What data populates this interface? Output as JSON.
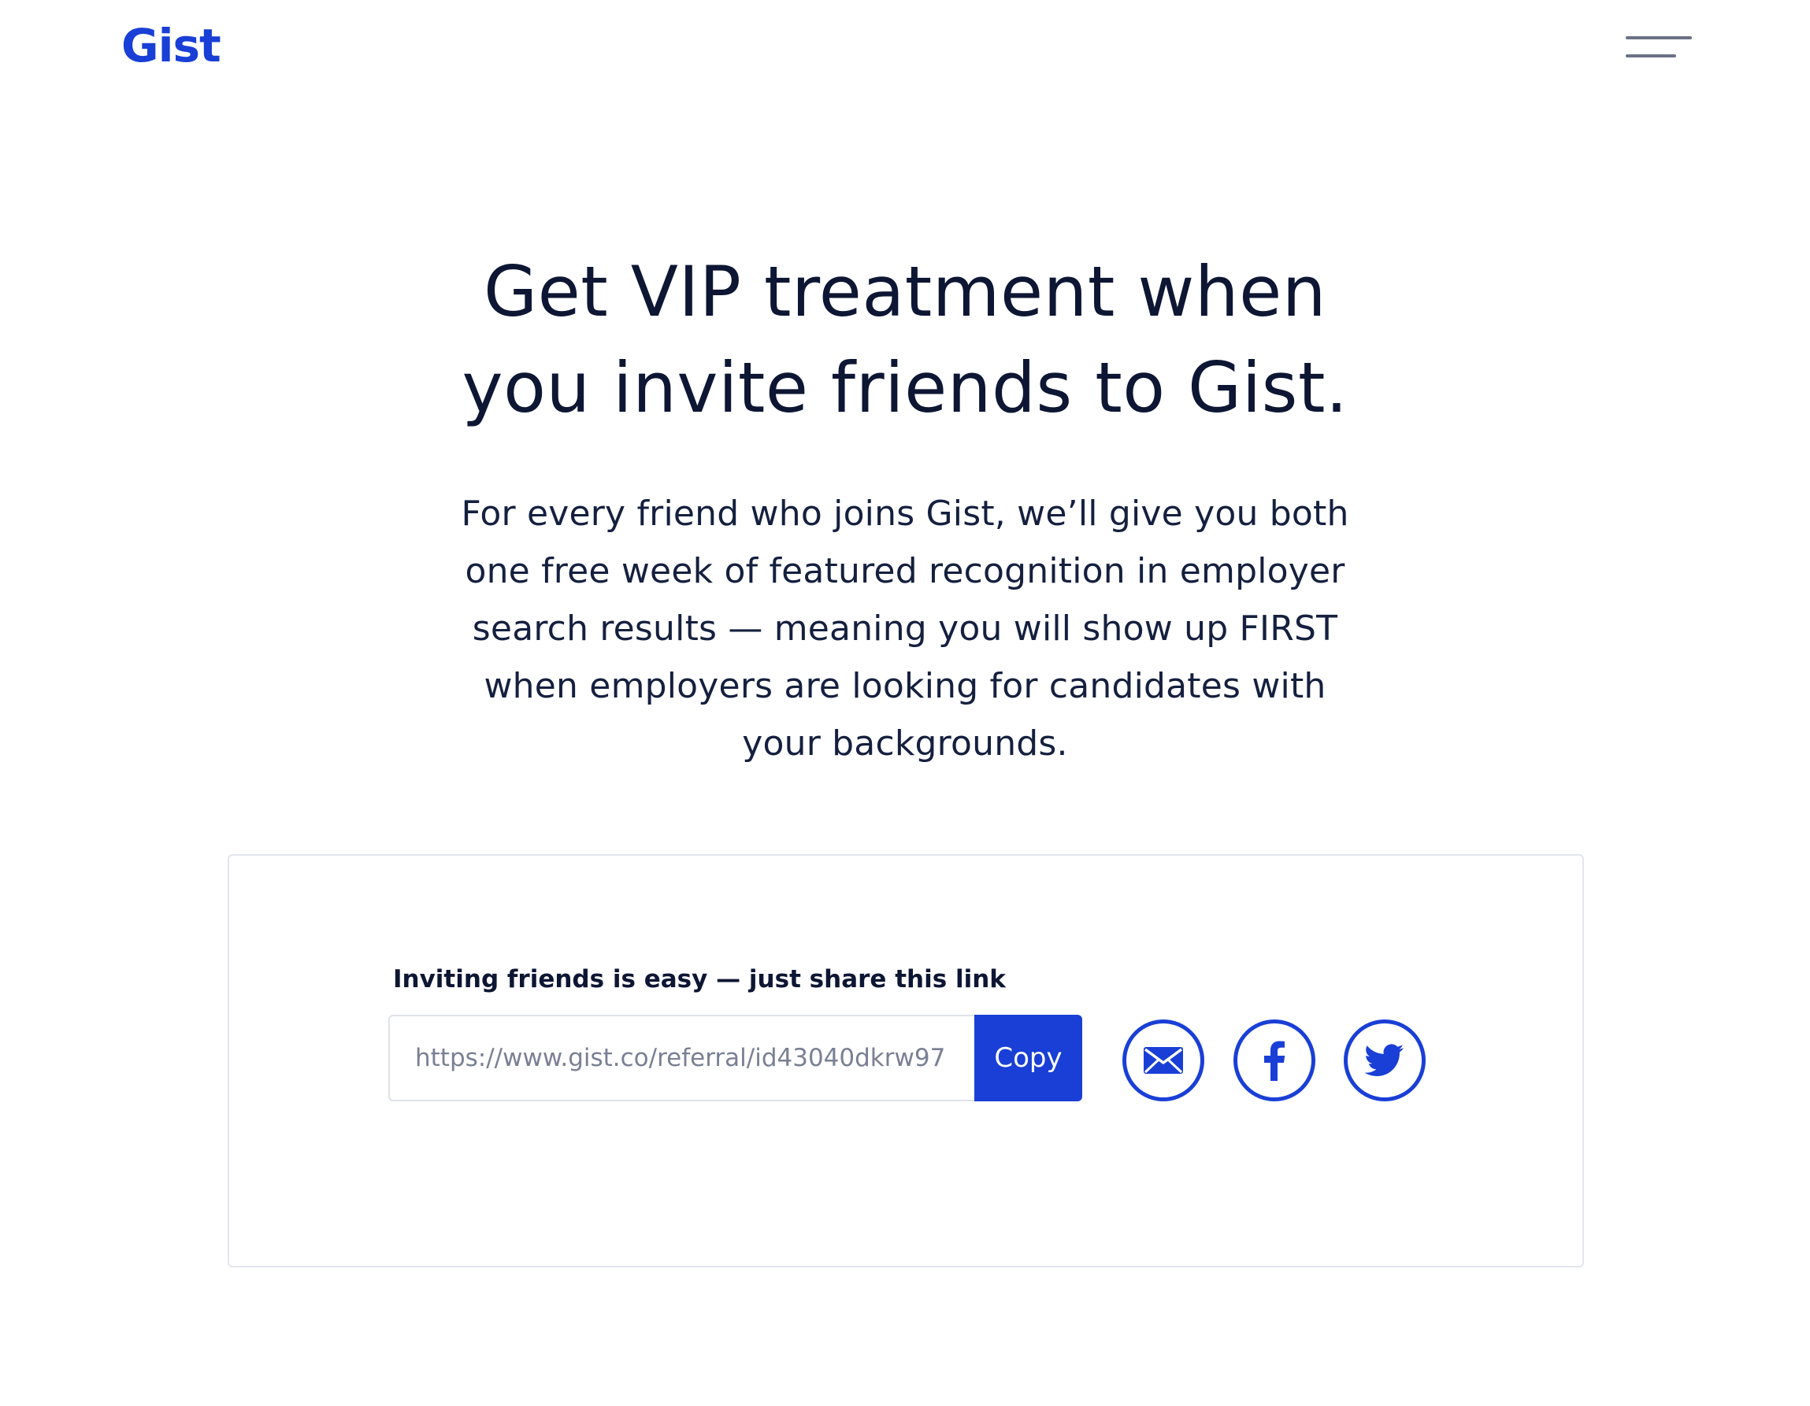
{
  "header": {
    "logo_text": "Gist",
    "menu_icon": "hamburger-menu-icon"
  },
  "hero": {
    "headline_line1": "Get VIP treatment when",
    "headline_line2": "you invite friends to Gist.",
    "subtext_line1": "For every friend who joins Gist, we’ll give you both",
    "subtext_line2": "one free week of featured recognition in employer",
    "subtext_line3": "search results — meaning you will show up FIRST",
    "subtext_line4": "when employers are looking for candidates with",
    "subtext_line5": "your backgrounds."
  },
  "invite": {
    "label": "Inviting friends is easy — just share this link",
    "link_value": "https://www.gist.co/referral/id43040dkrw97",
    "copy_label": "Copy",
    "share_icons": [
      "email-icon",
      "facebook-icon",
      "twitter-icon"
    ]
  },
  "colors": {
    "brand": "#1a3fd6",
    "text": "#0d1633",
    "muted": "#7a8094",
    "border": "#e3e6ec"
  }
}
